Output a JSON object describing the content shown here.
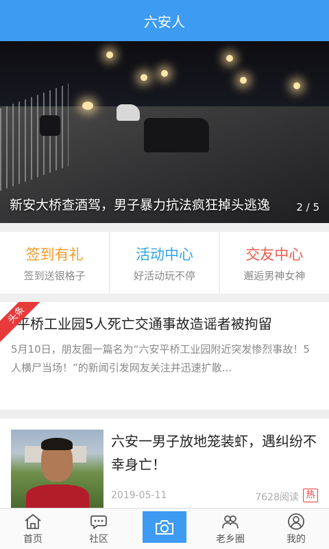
{
  "header": {
    "title": "六安人"
  },
  "banner": {
    "caption": "新安大桥查酒驾，男子暴力抗法疯狂掉头逃逸",
    "pager": "2 / 5"
  },
  "features": [
    {
      "title": "签到有礼",
      "subtitle": "签到送银格子",
      "color": "#f39a2a"
    },
    {
      "title": "活动中心",
      "subtitle": "好活动玩不停",
      "color": "#2ea5e8"
    },
    {
      "title": "交友中心",
      "subtitle": "邂逅男神女神",
      "color": "#ef5a4a"
    }
  ],
  "article1": {
    "badge": "头条",
    "title": "平桥工业园5人死亡交通事故造谣者被拘留",
    "summary": "5月10日，朋友圈一篇名为“六安平桥工业园附近突发惨烈事故！5人横尸当场！”的新闻引发网友关注并迅速扩散..."
  },
  "article2": {
    "title": "六安一男子放地笼装虾，遇纠纷不幸身亡！",
    "date": "2019-05-11",
    "reads": "7628阅读",
    "hot": "热"
  },
  "tabbar": [
    {
      "label": "首页",
      "icon": "home-icon"
    },
    {
      "label": "社区",
      "icon": "chat-icon"
    },
    {
      "label": "",
      "icon": "camera-icon"
    },
    {
      "label": "老乡圈",
      "icon": "people-icon"
    },
    {
      "label": "我的",
      "icon": "user-icon"
    }
  ],
  "colors": {
    "accent": "#3d9bf2",
    "hot": "#e83a3a"
  }
}
